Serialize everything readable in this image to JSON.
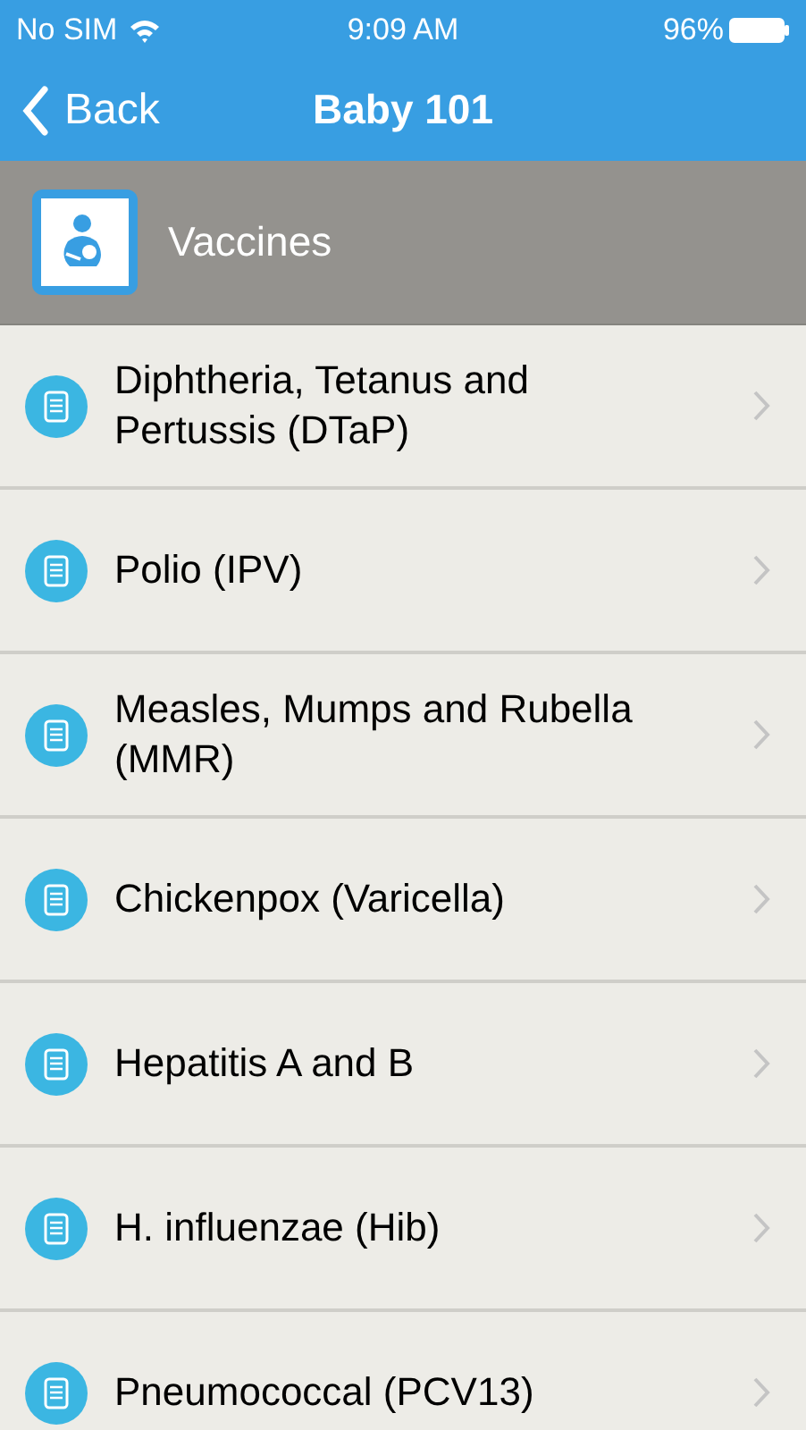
{
  "status_bar": {
    "carrier": "No SIM",
    "time": "9:09 AM",
    "battery": "96%"
  },
  "nav_bar": {
    "back": "Back",
    "title": "Baby 101"
  },
  "section": {
    "title": "Vaccines"
  },
  "items": [
    {
      "label": "Diphtheria, Tetanus and Pertussis (DTaP)"
    },
    {
      "label": "Polio (IPV)"
    },
    {
      "label": "Measles, Mumps and Rubella (MMR)"
    },
    {
      "label": "Chickenpox (Varicella)"
    },
    {
      "label": "Hepatitis A and B"
    },
    {
      "label": "H. influenzae (Hib)"
    },
    {
      "label": "Pneumococcal (PCV13)"
    }
  ]
}
